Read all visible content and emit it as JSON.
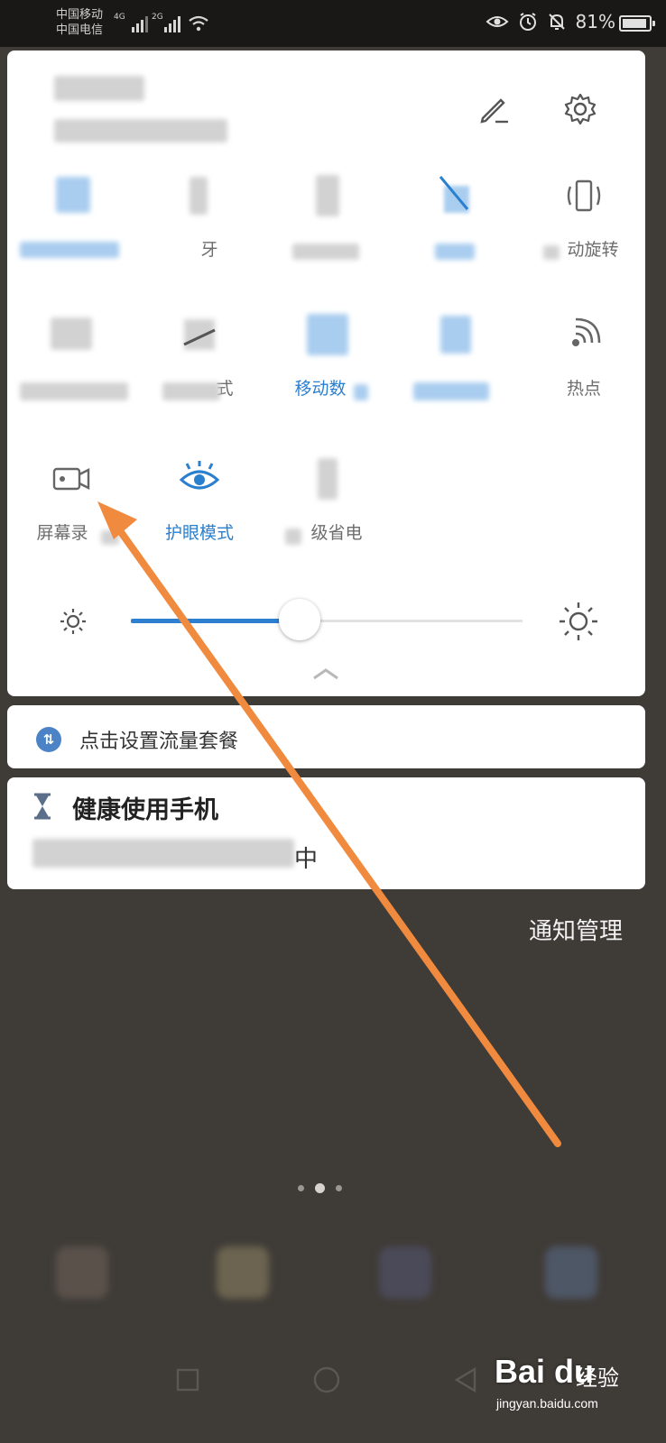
{
  "status_bar": {
    "carrier1": "中国移动",
    "carrier2": "中国电信",
    "net1": "4G",
    "net2": "2G",
    "battery": "81%",
    "icons": [
      "eye-icon",
      "alarm-icon",
      "bell-muted-icon",
      "battery-icon"
    ]
  },
  "quick_settings": {
    "tiles": [
      {
        "label": "",
        "icon": "wifi-icon",
        "active": true
      },
      {
        "label": "牙",
        "icon": "bluetooth-icon",
        "active": false
      },
      {
        "label": "",
        "icon": "flashlight-icon",
        "active": false
      },
      {
        "label": "",
        "icon": "bell-icon",
        "active": true
      },
      {
        "label": "动旋转",
        "icon": "rotate-icon",
        "active": false
      },
      {
        "label": "",
        "icon": "location-icon",
        "active": false
      },
      {
        "label": "式",
        "icon": "airplane-icon",
        "active": false
      },
      {
        "label": "移动数",
        "icon": "mobile-data-icon",
        "active": true
      },
      {
        "label": "",
        "icon": "nfc-icon",
        "active": true
      },
      {
        "label": "热点",
        "icon": "hotspot-icon",
        "active": false
      },
      {
        "label": "屏幕录",
        "icon": "screen-record-icon",
        "active": false
      },
      {
        "label": "护眼模式",
        "icon": "eye-comfort-icon",
        "active": true
      },
      {
        "label": "级省电",
        "icon": "power-save-icon",
        "active": false
      }
    ],
    "brightness_level": 0.43,
    "accent_color": "#2a7fcf"
  },
  "notifications": {
    "data_plan_text": "点击设置流量套餐",
    "health_title": "健康使用手机",
    "health_body_suffix": "中"
  },
  "notification_manage_label": "通知管理",
  "watermark": {
    "logo": "Bai du",
    "suffix": "经验",
    "url": "jingyan.baidu.com"
  },
  "annotation_color": "#f08a3e"
}
